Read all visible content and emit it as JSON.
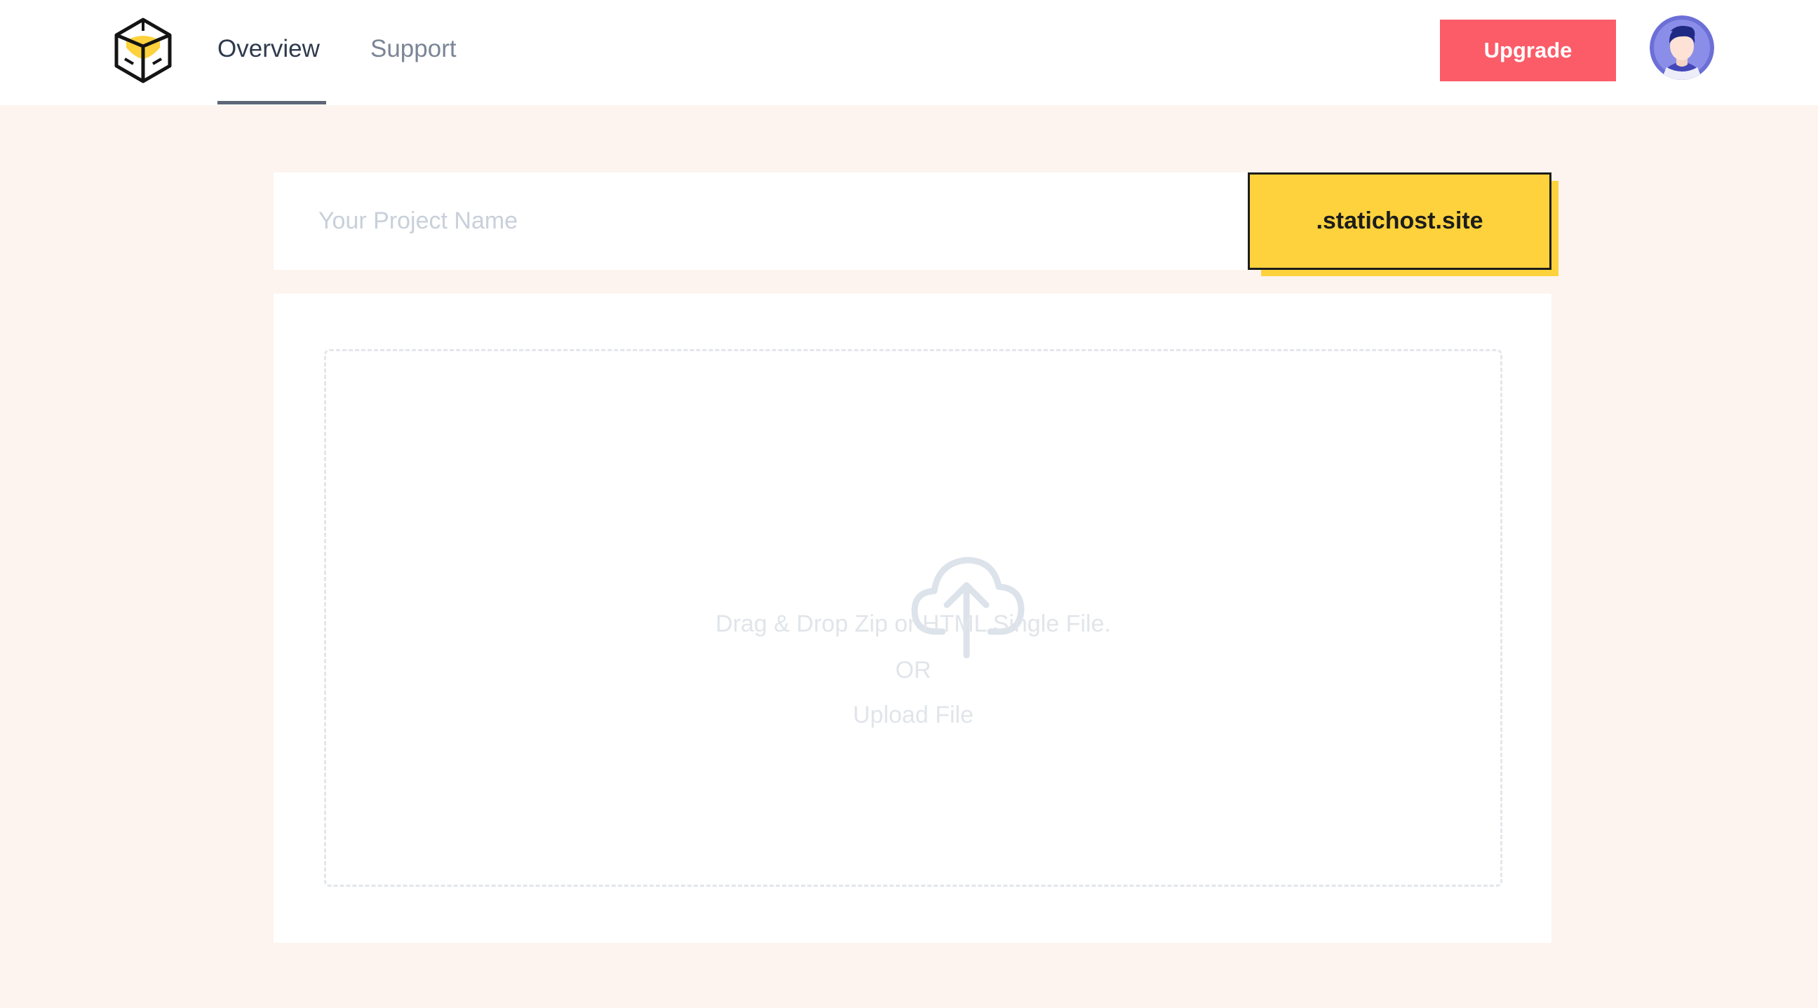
{
  "nav": {
    "items": [
      {
        "label": "Overview",
        "active": true
      },
      {
        "label": "Support",
        "active": false
      }
    ],
    "upgrade_label": "Upgrade"
  },
  "project": {
    "name_placeholder": "Your Project Name",
    "name_value": "",
    "domain_suffix": ".statichost.site"
  },
  "upload": {
    "instruction": "Drag & Drop Zip or HTML Single File.",
    "separator": "OR",
    "upload_link": "Upload File"
  },
  "colors": {
    "accent_yellow": "#fdd23c",
    "upgrade_red": "#fb5c68",
    "background": "#fdf4ef",
    "avatar_purple": "#6c6fd6"
  },
  "icons": {
    "logo": "cube-logo-icon",
    "upload": "cloud-upload-icon",
    "avatar": "user-avatar-icon"
  }
}
